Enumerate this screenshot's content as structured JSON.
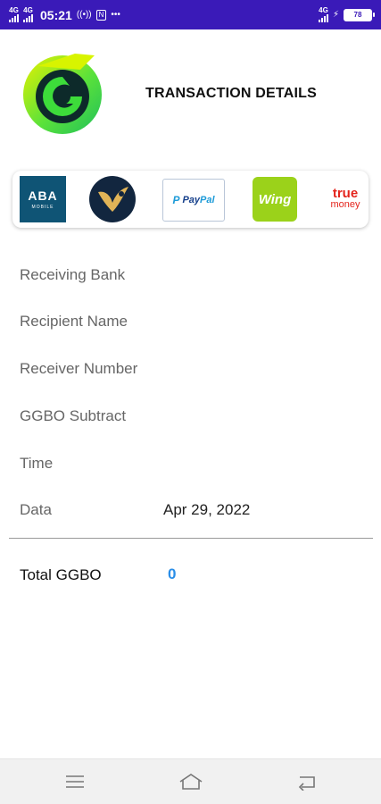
{
  "status_bar": {
    "signal1": "4G",
    "signal2": "4G",
    "time": "05:21",
    "net_right": "4G",
    "battery": "78"
  },
  "header": {
    "title": "TRANSACTION DETAILS",
    "logo_icon": "ggbo-logo-icon"
  },
  "providers": {
    "aba": {
      "line1": "ABA",
      "line2": "MOBILE"
    },
    "paypal": {
      "part1": "Pay",
      "part2": "Pal"
    },
    "wing": {
      "label": "Wing"
    },
    "truemoney": {
      "line1": "true",
      "line2": "money"
    }
  },
  "details": {
    "receiving_bank": {
      "label": "Receiving Bank",
      "value": ""
    },
    "recipient_name": {
      "label": "Recipient Name",
      "value": ""
    },
    "receiver_number": {
      "label": "Receiver Number",
      "value": ""
    },
    "ggbo_subtract": {
      "label": "GGBO Subtract",
      "value": ""
    },
    "time": {
      "label": "Time",
      "value": ""
    },
    "data": {
      "label": "Data",
      "value": "Apr 29, 2022"
    }
  },
  "total": {
    "label": "Total GGBO",
    "value": "0"
  },
  "colors": {
    "status_bar": "#3a1ab8",
    "accent": "#2a8ee8",
    "logo_green": "#3ddc3a",
    "logo_yellow": "#d6f000"
  },
  "nav": {
    "icons": [
      "menu-icon",
      "home-icon",
      "back-icon"
    ]
  }
}
